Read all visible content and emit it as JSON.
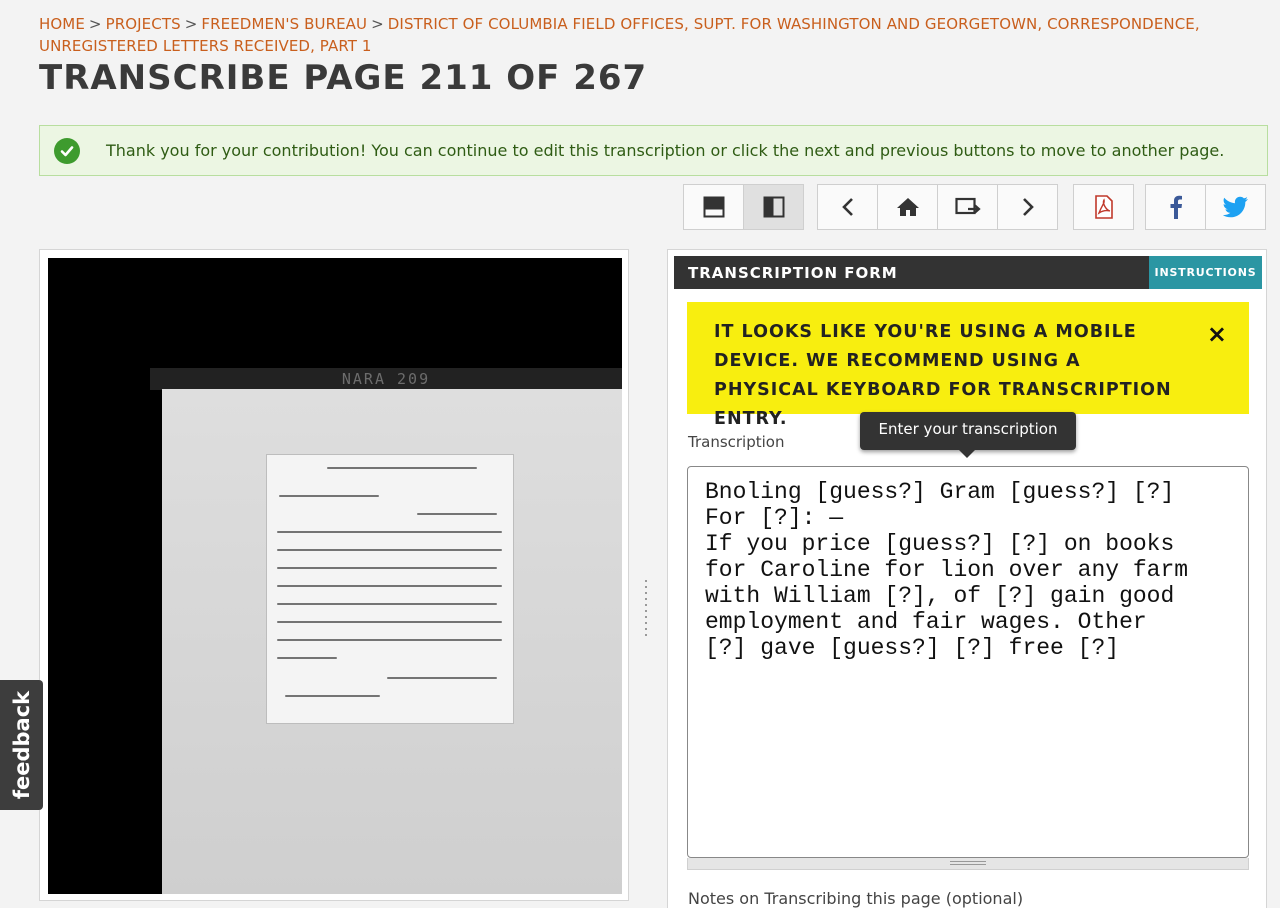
{
  "breadcrumb": {
    "items": [
      "HOME",
      "PROJECTS",
      "FREEDMEN'S BUREAU",
      "DISTRICT OF COLUMBIA FIELD OFFICES, SUPT. FOR WASHINGTON AND GEORGETOWN, CORRESPONDENCE,"
    ],
    "continuation": "UNREGISTERED LETTERS RECEIVED, PART 1",
    "separator": ">"
  },
  "page_title": "TRANSCRIBE PAGE 211 OF 267",
  "alert": {
    "message": "Thank you for your contribution! You can continue to edit this transcription or click the next and previous buttons to move to another page.",
    "icon": "check-circle-icon",
    "color": "#3e9b2e"
  },
  "toolbar": {
    "buttons": [
      "layout-horizontal-icon",
      "layout-vertical-icon",
      "previous-icon",
      "home-icon",
      "switch-icon",
      "next-icon",
      "pdf-icon",
      "facebook-icon",
      "twitter-icon"
    ]
  },
  "viewer": {
    "scan_strip_text": "NARA 209"
  },
  "form": {
    "header": "TRANSCRIPTION FORM",
    "instructions_label": "INSTRUCTIONS",
    "mobile_warning": "IT LOOKS LIKE YOU'RE USING A MOBILE DEVICE. WE RECOMMEND USING A PHYSICAL KEYBOARD FOR TRANSCRIPTION ENTRY.",
    "close_label": "×",
    "tooltip": "Enter your transcription",
    "transcription_label": "Transcription",
    "transcription_value": "Bnoling [guess?] Gram [guess?] [?]\nFor [?]: —\nIf you price [guess?] [?] on books\nfor Caroline for lion over any farm\nwith William [?], of [?] gain good\nemployment and fair wages. Other\n[?] gave [guess?] [?] free [?]",
    "notes_label": "Notes on Transcribing this page (optional)"
  },
  "feedback_label": "feedback",
  "colors": {
    "link": "#c95f1d",
    "header_bg": "#333333",
    "instructions_bg": "#2b96a3",
    "warning_bg": "#f8ee0f",
    "alert_bg": "#ecf6e3"
  }
}
